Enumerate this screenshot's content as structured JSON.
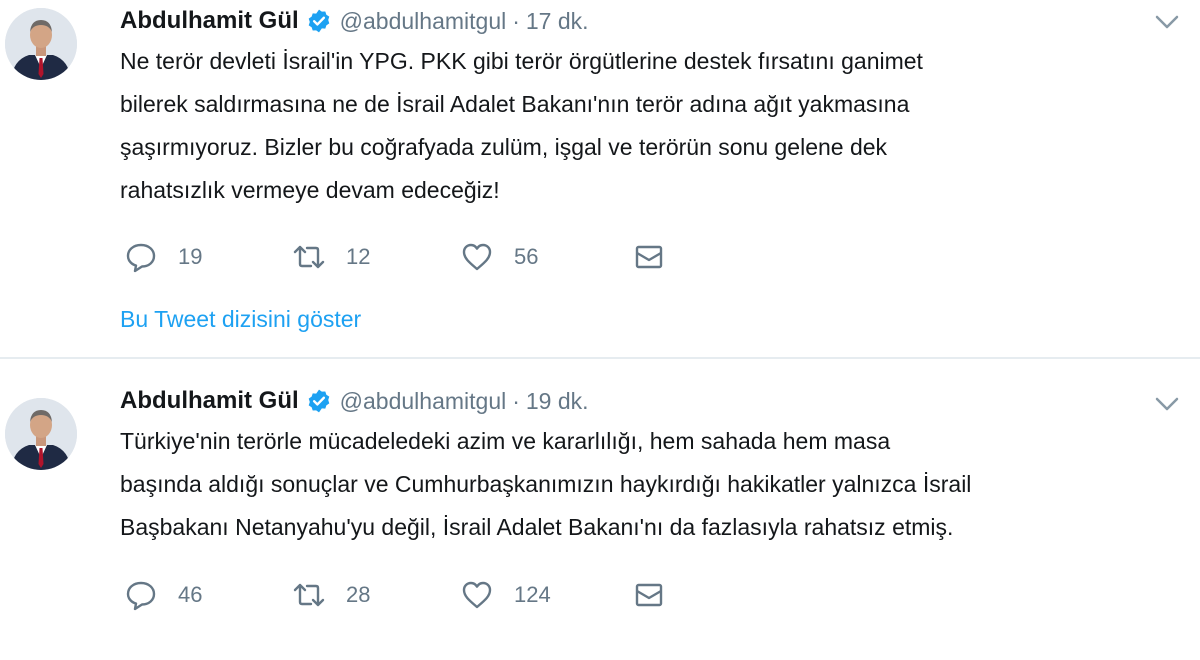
{
  "colors": {
    "accent": "#1da1f2",
    "text": "#14171a",
    "muted": "#657786"
  },
  "tweets": [
    {
      "author_name": "Abdulhamit Gül",
      "handle": "@abdulhamitgul",
      "separator": "·",
      "time": "17 dk.",
      "lines": [
        "Ne terör devleti İsrail'in YPG. PKK gibi terör örgütlerine destek fırsatını ganimet",
        "bilerek saldırmasına ne de İsrail Adalet Bakanı'nın terör adına ağıt yakmasına",
        "şaşırmıyoruz. Bizler bu coğrafyada zulüm, işgal ve terörün sonu gelene dek",
        "rahatsızlık vermeye devam edeceğiz!"
      ],
      "replies": "19",
      "retweets": "12",
      "likes": "56",
      "thread_link": "Bu Tweet dizisini göster"
    },
    {
      "author_name": "Abdulhamit Gül",
      "handle": "@abdulhamitgul",
      "separator": "·",
      "time": "19 dk.",
      "lines": [
        "Türkiye'nin terörle mücadeledeki azim ve kararlılığı, hem sahada hem masa",
        "başında aldığı sonuçlar ve Cumhurbaşkanımızın haykırdığı hakikatler yalnızca İsrail",
        "Başbakanı Netanyahu'yu değil, İsrail Adalet Bakanı'nı da fazlasıyla rahatsız etmiş."
      ],
      "replies": "46",
      "retweets": "28",
      "likes": "124"
    }
  ]
}
